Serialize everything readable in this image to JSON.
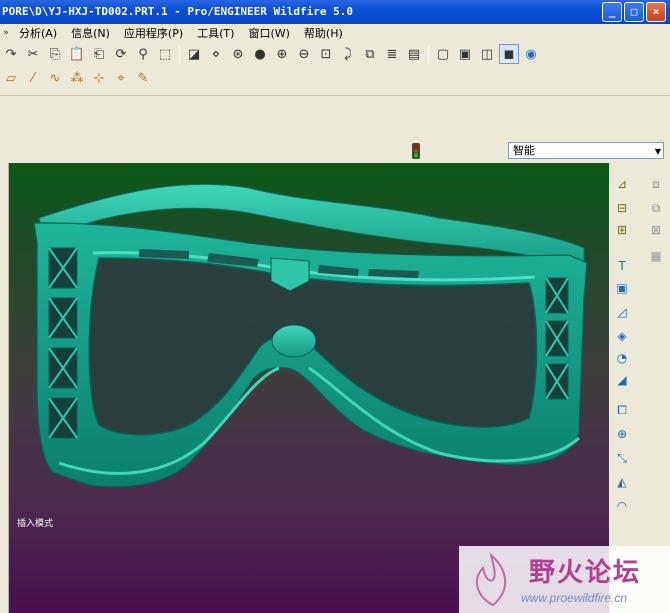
{
  "window": {
    "title": "PORE\\D\\YJ-HXJ-TD002.PRT.1 - Pro/ENGINEER Wildfire 5.0",
    "min_label": "_",
    "max_label": "□",
    "close_label": "×"
  },
  "menu": [
    {
      "label": "分析(A)"
    },
    {
      "label": "信息(N)"
    },
    {
      "label": "应用程序(P)"
    },
    {
      "label": "工具(T)"
    },
    {
      "label": "窗口(W)"
    },
    {
      "label": "帮助(H)"
    }
  ],
  "filter": {
    "value": "智能",
    "arrow": "▼"
  },
  "viewport": {
    "mode_text": "插入模式"
  },
  "watermark": {
    "title": "野火论坛",
    "url": "www.proewildfire.cn"
  },
  "colors": {
    "model": "#1fb59b",
    "bg_top": "#0a5a17",
    "bg_bottom": "#4a0f4f",
    "title_bar": "#0a4fd6"
  }
}
